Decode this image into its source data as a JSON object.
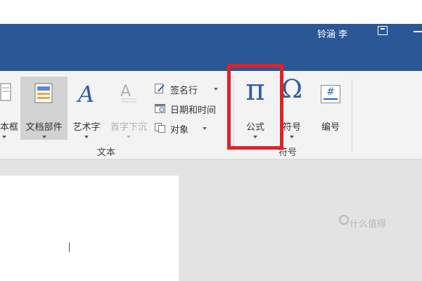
{
  "titlebar": {
    "user_name": "铃涵 李"
  },
  "ribbon": {
    "items": {
      "textbox": "本框",
      "doc_parts": "文档部件",
      "wordart": "艺术字",
      "dropcap": "首字下沉",
      "equation": "公式",
      "equation_icon": "π",
      "symbol": "符号",
      "symbol_icon": "Ω",
      "number": "编号",
      "number_icon": "#"
    },
    "small_buttons": {
      "signature_line": "签名行",
      "date_time": "日期和时间",
      "object": "对象"
    },
    "groups": {
      "text": "文本",
      "symbols": "符号"
    }
  },
  "colors": {
    "title_bar": "#2b5797",
    "ribbon": "#f3f3f3",
    "accent_blue": "#2b5fa8",
    "highlight": "#e32127"
  },
  "watermark": "什么值得"
}
